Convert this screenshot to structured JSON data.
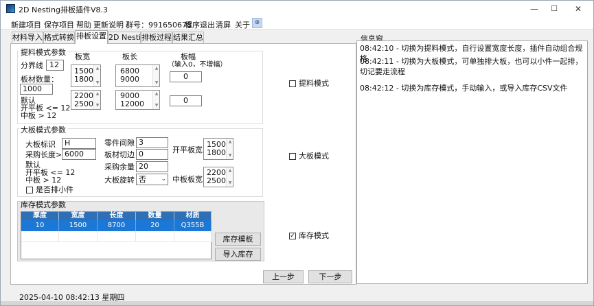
{
  "window": {
    "title": "2D Nesting排板插件V8.3",
    "min": "—",
    "max": "☐",
    "close": "✕"
  },
  "menu": [
    "新建项目",
    "保存项目",
    "帮助",
    "更新说明",
    "群号：991650678",
    "程序退出",
    "清屏",
    "关于"
  ],
  "menu_pin": "⊕",
  "tabs": [
    "材料导入",
    "格式转换",
    "排板设置",
    "2D Nesting",
    "排板过程",
    "结果汇总"
  ],
  "active_tab": "排板设置",
  "strip_mode": {
    "title": "提料模式参数",
    "dividing_line_label": "分界线",
    "dividing_line_value": "12",
    "plate_width_header": "板宽",
    "plate_length_header": "板长",
    "plate_breadth_header": "板幅",
    "plate_breadth_note": "（输入0，不增幅）",
    "count_label": "板材数量：",
    "count_value": "1000",
    "widths_a": [
      "1500",
      "1800"
    ],
    "lengths_a": [
      "6800",
      "9000"
    ],
    "breadth_a": "0",
    "widths_b": [
      "2200",
      "2500"
    ],
    "lengths_b": [
      "9000",
      "12000"
    ],
    "breadth_b": "0",
    "default_label": "默认",
    "flat_rule": "开平板 <= 12",
    "mid_rule": "中板     > 12",
    "checkbox_label": "提料模式",
    "checked": false
  },
  "big_mode": {
    "title": "大板模式参数",
    "flag_label": "大板标识",
    "flag_value": "H",
    "purchase_label": "采购长度>",
    "purchase_value": "6000",
    "gap_label": "零件间隙",
    "gap_value": "3",
    "edge_label": "板材切边",
    "edge_value": "0",
    "margin_label": "采购余量",
    "margin_value": "20",
    "rotate_label": "大板旋转",
    "rotate_value": "否",
    "flat_width_label": "开平板宽",
    "flat_widths": [
      "1500",
      "1800"
    ],
    "mid_width_label": "中板板宽",
    "mid_widths": [
      "2200",
      "2500"
    ],
    "default_label": "默认",
    "flat_rule": "开平板 <= 12",
    "mid_rule": "中板     > 12",
    "small_parts_label": "是否排小件",
    "small_parts_checked": false,
    "checkbox_label": "大板模式",
    "checked": false
  },
  "stock_mode": {
    "title": "库存模式参数",
    "columns": [
      "厚度",
      "宽度",
      "长度",
      "数量",
      "材质"
    ],
    "rows": [
      [
        "10",
        "1500",
        "8700",
        "20",
        "Q355B"
      ]
    ],
    "template_button": "库存模板",
    "import_button": "导入库存",
    "checkbox_label": "库存模式",
    "checked": true
  },
  "nav": {
    "prev": "上一步",
    "next": "下一步"
  },
  "info": {
    "title": "信息窗",
    "lines": [
      "08:42:10 - 切换为提料模式，自行设置宽度长度，插件自动组合规格",
      "08:42:11 - 切换为大板模式，可单独排大板，也可以小件一起排，切记要走流程",
      "08:42:12 - 切换为库存模式，手动输入，或导入库存CSV文件"
    ]
  },
  "status": "2025-04-10 08:42:13 星期四"
}
